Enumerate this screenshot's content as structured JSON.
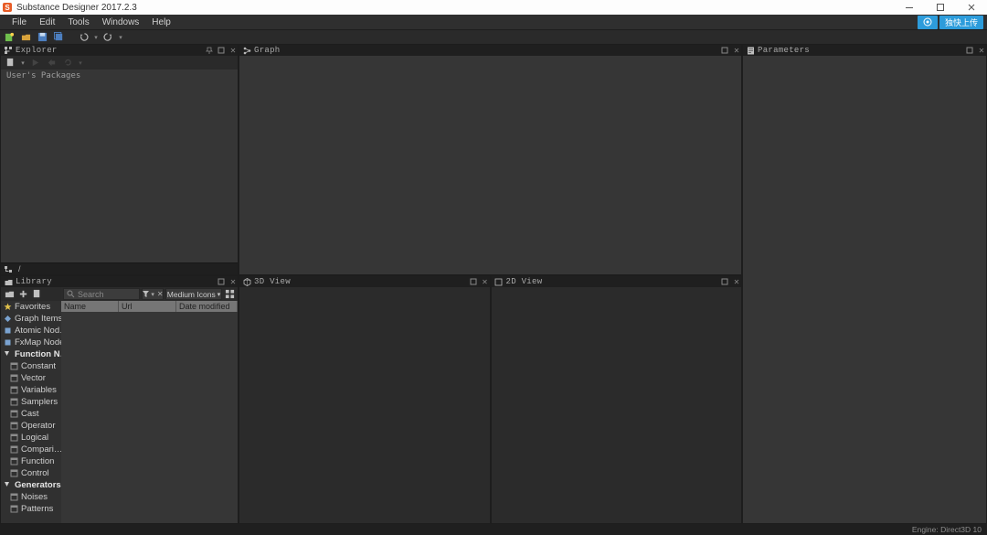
{
  "app": {
    "title": "Substance Designer 2017.2.3"
  },
  "menu": {
    "items": [
      "File",
      "Edit",
      "Tools",
      "Windows",
      "Help"
    ]
  },
  "topright": {
    "upload_label": "独快上传"
  },
  "panels": {
    "explorer": {
      "title": "Explorer",
      "root_label": "User's Packages",
      "breadcrumb": [
        "/"
      ]
    },
    "graph": {
      "title": "Graph"
    },
    "parameters": {
      "title": "Parameters"
    },
    "library": {
      "title": "Library"
    },
    "view3d": {
      "title": "3D View"
    },
    "view2d": {
      "title": "2D View"
    }
  },
  "library": {
    "search_placeholder": "Search",
    "size_label": "Medium Icons",
    "columns": [
      "Name",
      "Url",
      "Date modified"
    ],
    "tree": [
      {
        "label": "Favorites",
        "icon": "star",
        "indent": 0
      },
      {
        "label": "Graph Items",
        "icon": "diamond",
        "indent": 0
      },
      {
        "label": "Atomic Nod…",
        "icon": "cube",
        "indent": 0
      },
      {
        "label": "FxMap Nodes",
        "icon": "cube",
        "indent": 0
      },
      {
        "label": "Function N…",
        "icon": "triangle",
        "indent": 0,
        "expanded": true,
        "bold": true
      },
      {
        "label": "Constant",
        "icon": "box",
        "indent": 1
      },
      {
        "label": "Vector",
        "icon": "box",
        "indent": 1
      },
      {
        "label": "Variables",
        "icon": "box",
        "indent": 1
      },
      {
        "label": "Samplers",
        "icon": "box",
        "indent": 1
      },
      {
        "label": "Cast",
        "icon": "box",
        "indent": 1
      },
      {
        "label": "Operator",
        "icon": "box",
        "indent": 1
      },
      {
        "label": "Logical",
        "icon": "box",
        "indent": 1
      },
      {
        "label": "Compari…",
        "icon": "box",
        "indent": 1
      },
      {
        "label": "Function",
        "icon": "box",
        "indent": 1
      },
      {
        "label": "Control",
        "icon": "box",
        "indent": 1
      },
      {
        "label": "Generators",
        "icon": "triangle",
        "indent": 0,
        "expanded": true,
        "bold": true
      },
      {
        "label": "Noises",
        "icon": "box",
        "indent": 1
      },
      {
        "label": "Patterns",
        "icon": "box",
        "indent": 1
      }
    ]
  },
  "status": {
    "engine": "Engine: Direct3D 10"
  }
}
